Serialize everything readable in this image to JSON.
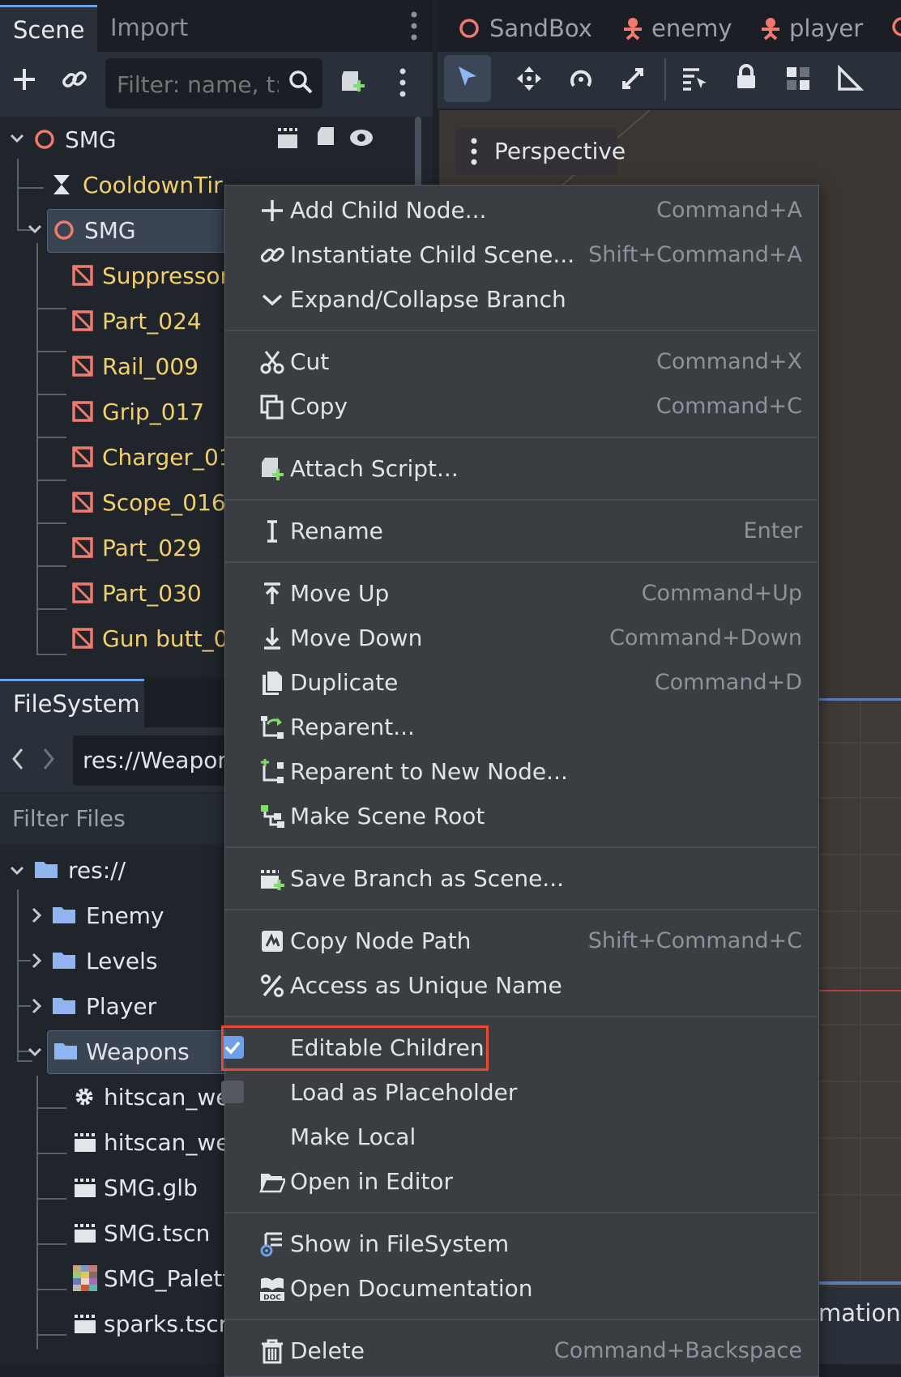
{
  "scene_dock": {
    "tabs": [
      {
        "label": "Scene"
      },
      {
        "label": "Import"
      }
    ],
    "filter_placeholder": "Filter: name, t:t",
    "tree": [
      {
        "label": "SMG",
        "color": "white",
        "indent": 0,
        "expanded": true
      },
      {
        "label": "CooldownTir",
        "color": "yellow",
        "indent": 1
      },
      {
        "label": "SMG",
        "color": "white",
        "indent": 1,
        "expanded": true,
        "selected": true
      },
      {
        "label": "Suppressor",
        "color": "yellow",
        "indent": 2
      },
      {
        "label": "Part_024",
        "color": "yellow",
        "indent": 2
      },
      {
        "label": "Rail_009",
        "color": "yellow",
        "indent": 2
      },
      {
        "label": "Grip_017",
        "color": "yellow",
        "indent": 2
      },
      {
        "label": "Charger_01",
        "color": "yellow",
        "indent": 2
      },
      {
        "label": "Scope_016",
        "color": "yellow",
        "indent": 2
      },
      {
        "label": "Part_029",
        "color": "yellow",
        "indent": 2
      },
      {
        "label": "Part_030",
        "color": "yellow",
        "indent": 2
      },
      {
        "label": "Gun butt_0",
        "color": "yellow",
        "indent": 2
      }
    ]
  },
  "filesystem": {
    "tab_label": "FileSystem",
    "path": "res://Weapon",
    "filter_label": "Filter Files",
    "tree": [
      {
        "label": "res://",
        "type": "folder",
        "indent": 0,
        "expanded": true
      },
      {
        "label": "Enemy",
        "type": "folder",
        "indent": 1
      },
      {
        "label": "Levels",
        "type": "folder",
        "indent": 1
      },
      {
        "label": "Player",
        "type": "folder",
        "indent": 1
      },
      {
        "label": "Weapons",
        "type": "folder",
        "indent": 1,
        "expanded": true,
        "selected": true
      },
      {
        "label": "hitscan_we",
        "type": "gear",
        "indent": 2
      },
      {
        "label": "hitscan_we",
        "type": "scene",
        "indent": 2
      },
      {
        "label": "SMG.glb",
        "type": "scene",
        "indent": 2
      },
      {
        "label": "SMG.tscn",
        "type": "scene",
        "indent": 2
      },
      {
        "label": "SMG_Palett",
        "type": "image",
        "indent": 2
      },
      {
        "label": "sparks.tscr",
        "type": "scene",
        "indent": 2
      }
    ]
  },
  "viewport": {
    "scene_tabs": [
      {
        "label": "SandBox"
      },
      {
        "label": "enemy"
      },
      {
        "label": "player"
      }
    ],
    "perspective_label": "Perspective",
    "bottom_label": "mation"
  },
  "context_menu": {
    "groups": [
      [
        {
          "icon": "plus-icon",
          "label": "Add Child Node...",
          "shortcut": "Command+A"
        },
        {
          "icon": "link-icon",
          "label": "Instantiate Child Scene...",
          "shortcut": "Shift+Command+A"
        },
        {
          "icon": "chevron-down-icon",
          "label": "Expand/Collapse Branch",
          "shortcut": ""
        }
      ],
      [
        {
          "icon": "scissors-icon",
          "label": "Cut",
          "shortcut": "Command+X"
        },
        {
          "icon": "copy-icon",
          "label": "Copy",
          "shortcut": "Command+C"
        }
      ],
      [
        {
          "icon": "attach-script-icon",
          "label": "Attach Script...",
          "shortcut": ""
        }
      ],
      [
        {
          "icon": "rename-icon",
          "label": "Rename",
          "shortcut": "Enter"
        }
      ],
      [
        {
          "icon": "move-up-icon",
          "label": "Move Up",
          "shortcut": "Command+Up"
        },
        {
          "icon": "move-down-icon",
          "label": "Move Down",
          "shortcut": "Command+Down"
        },
        {
          "icon": "duplicate-icon",
          "label": "Duplicate",
          "shortcut": "Command+D"
        },
        {
          "icon": "reparent-icon",
          "label": "Reparent...",
          "shortcut": ""
        },
        {
          "icon": "reparent-new-icon",
          "label": "Reparent to New Node...",
          "shortcut": ""
        },
        {
          "icon": "scene-root-icon",
          "label": "Make Scene Root",
          "shortcut": ""
        }
      ],
      [
        {
          "icon": "save-branch-icon",
          "label": "Save Branch as Scene...",
          "shortcut": ""
        }
      ],
      [
        {
          "icon": "node-path-icon",
          "label": "Copy Node Path",
          "shortcut": "Shift+Command+C"
        },
        {
          "icon": "percent-icon",
          "label": "Access as Unique Name",
          "shortcut": ""
        }
      ],
      [
        {
          "icon": "checkbox-checked-icon",
          "label": "Editable Children",
          "shortcut": "",
          "checked": true
        },
        {
          "icon": "checkbox-empty-icon",
          "label": "Load as Placeholder",
          "shortcut": "",
          "checked": false
        },
        {
          "icon": "",
          "label": "Make Local",
          "shortcut": ""
        },
        {
          "icon": "folder-open-icon",
          "label": "Open in Editor",
          "shortcut": ""
        }
      ],
      [
        {
          "icon": "show-filesystem-icon",
          "label": "Show in FileSystem",
          "shortcut": ""
        },
        {
          "icon": "documentation-icon",
          "label": "Open Documentation",
          "shortcut": ""
        }
      ],
      [
        {
          "icon": "trash-icon",
          "label": "Delete",
          "shortcut": "Command+Backspace"
        }
      ]
    ]
  },
  "colors": {
    "accent": "#6ea0e6",
    "node_yellow": "#f2cf6b",
    "node_red": "#f07a6e",
    "highlight": "#e54b30"
  }
}
